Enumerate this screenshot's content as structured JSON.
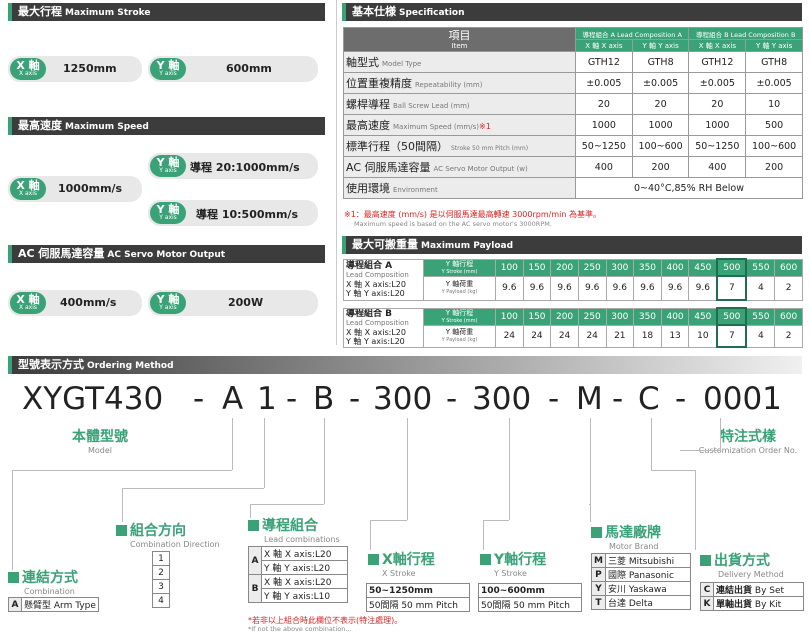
{
  "stroke": {
    "title_zh": "最大行程",
    "title_en": "Maximum Stroke",
    "x_label": "X 軸",
    "x_sub": "X axis",
    "x_value": "1250mm",
    "y_label": "Y 軸",
    "y_sub": "Y axis",
    "y_value": "600mm"
  },
  "speed": {
    "title_zh": "最高速度",
    "title_en": "Maximum Speed",
    "x_label": "X 軸",
    "x_sub": "X axis",
    "x_value": "1000mm/s",
    "y_label": "Y 軸",
    "y_sub": "Y axis",
    "y_value1": "導程 20:1000mm/s",
    "y_value2": "導程 10:500mm/s"
  },
  "motor": {
    "title_zh": "AC 伺服馬達容量",
    "title_en": "AC Servo Motor Output",
    "x_label": "X 軸",
    "x_sub": "X axis",
    "x_value": "400mm/s",
    "y_label": "Y 軸",
    "y_sub": "Y axis",
    "y_value": "200W"
  },
  "spec": {
    "title_zh": "基本仕様",
    "title_en": "Specification",
    "item_zh": "項目",
    "item_en": "Item",
    "group_a": "導程組合 A Lead Composition A",
    "group_b": "導程組合 B Lead Composition B",
    "sub_heads": [
      "X 軸 X axis",
      "Y 軸 Y axis",
      "X 軸 X axis",
      "Y 軸 Y axis"
    ],
    "rows": [
      {
        "zh": "軸型式",
        "en": "Model Type",
        "v": [
          "GTH12",
          "GTH8",
          "GTH12",
          "GTH8"
        ]
      },
      {
        "zh": "位置重複精度",
        "en": "Repeatability (mm)",
        "v": [
          "±0.005",
          "±0.005",
          "±0.005",
          "±0.005"
        ]
      },
      {
        "zh": "螺桿導程",
        "en": "Ball Screw Lead (mm)",
        "v": [
          "20",
          "20",
          "20",
          "10"
        ]
      },
      {
        "zh": "最高速度",
        "en": "Maximum Speed (mm/s)",
        "mark": "※1",
        "v": [
          "1000",
          "1000",
          "1000",
          "500"
        ]
      },
      {
        "zh": "標準行程（50間隔）",
        "en": "Stroke 50 mm Pitch (mm)",
        "v": [
          "50~1250",
          "100~600",
          "50~1250",
          "100~600"
        ]
      },
      {
        "zh": "AC 伺服馬達容量",
        "en": "AC Servo Motor Output (w)",
        "v": [
          "400",
          "200",
          "400",
          "200"
        ]
      }
    ],
    "env": {
      "zh": "使用環境",
      "en": "Environment",
      "v": "0~40°C,85% RH Below"
    },
    "note1": "※1：最高速度 (mm/s) 是以伺服馬達最高轉速 3000rpm/min 為基準。",
    "note2": "Maximum speed is based on the AC servo motor's 3000RPM."
  },
  "payload": {
    "title_zh": "最大可搬重量",
    "title_en": "Maximum Payload",
    "a_title": "導程組合 A",
    "a_sub": "Lead Composition",
    "a_x": "X 軸 X axis:L20",
    "a_y": "Y 軸 Y axis:L20",
    "b_title": "導程組合 B",
    "b_sub": "Lead Composition",
    "b_x": "X 軸 X axis:L20",
    "b_y": "Y 軸 Y axis:L20",
    "stroke_head": "Y 軸行程",
    "stroke_head_en": "Y Stroke (mm)",
    "load_head": "Y 軸荷重",
    "load_head_en": "Y Payload (kg)",
    "strokes": [
      "100",
      "150",
      "200",
      "250",
      "300",
      "350",
      "400",
      "450",
      "500",
      "550",
      "600"
    ],
    "a_loads": [
      "9.6",
      "9.6",
      "9.6",
      "9.6",
      "9.6",
      "9.6",
      "9.6",
      "9.6",
      "7",
      "4",
      "2"
    ],
    "b_loads": [
      "24",
      "24",
      "24",
      "24",
      "21",
      "18",
      "13",
      "10",
      "7",
      "4",
      "2"
    ]
  },
  "order": {
    "title_zh": "型號表示方式",
    "title_en": "Ordering Method",
    "code": [
      "XYGT430",
      "-",
      "A",
      "1",
      "-",
      "B",
      "-",
      "300",
      "-",
      "300",
      "-",
      "M",
      "-",
      "C",
      "-",
      "0001"
    ],
    "model_zh": "本體型號",
    "model_en": "Model",
    "custom_zh": "特注式樣",
    "custom_en": "Customization Order No.",
    "combination_zh": "連結方式",
    "combination_en": "Combination",
    "combination_opt_k": "A",
    "combination_opt": "懸臂型",
    "combination_opt_en": "Arm Type",
    "direction_zh": "組合方向",
    "direction_en": "Combination Direction",
    "direction_opts": [
      "1",
      "2",
      "3",
      "4"
    ],
    "lead_zh": "導程組合",
    "lead_en": "Lead combinations",
    "lead_a_x": "X 軸 X axis:L20",
    "lead_a_y": "Y 軸 Y axis:L20",
    "lead_b_x": "X 軸 X axis:L20",
    "lead_b_y": "Y 軸 Y axis:L10",
    "lead_note": "*若非以上組合時此欄位不表示(特注處理)。",
    "lead_note_en": "*If not the above combination...",
    "xs_zh": "X軸行程",
    "xs_en": "X Stroke",
    "xs_range": "50~1250mm",
    "xs_pitch": "50間隔",
    "xs_pitch_en": "50 mm Pitch",
    "ys_zh": "Y軸行程",
    "ys_en": "Y Stroke",
    "ys_range": "100~600mm",
    "ys_pitch": "50間隔",
    "ys_pitch_en": "50 mm Pitch",
    "motor_zh": "馬達廠牌",
    "motor_en": "Motor Brand",
    "motor_opts": [
      {
        "k": "M",
        "zh": "三菱",
        "en": "Mitsubishi"
      },
      {
        "k": "P",
        "zh": "國際",
        "en": "Panasonic"
      },
      {
        "k": "Y",
        "zh": "安川",
        "en": "Yaskawa"
      },
      {
        "k": "T",
        "zh": "台達",
        "en": "Delta"
      }
    ],
    "delivery_zh": "出貨方式",
    "delivery_en": "Delivery Method",
    "delivery_opts": [
      {
        "k": "C",
        "zh": "連結出貨",
        "en": "By Set"
      },
      {
        "k": "K",
        "zh": "單軸出貨",
        "en": "By Kit"
      }
    ]
  },
  "colors": {
    "accent": "#3aa277",
    "header": "#3c3c3c",
    "highlight_row": "#3aa277"
  }
}
